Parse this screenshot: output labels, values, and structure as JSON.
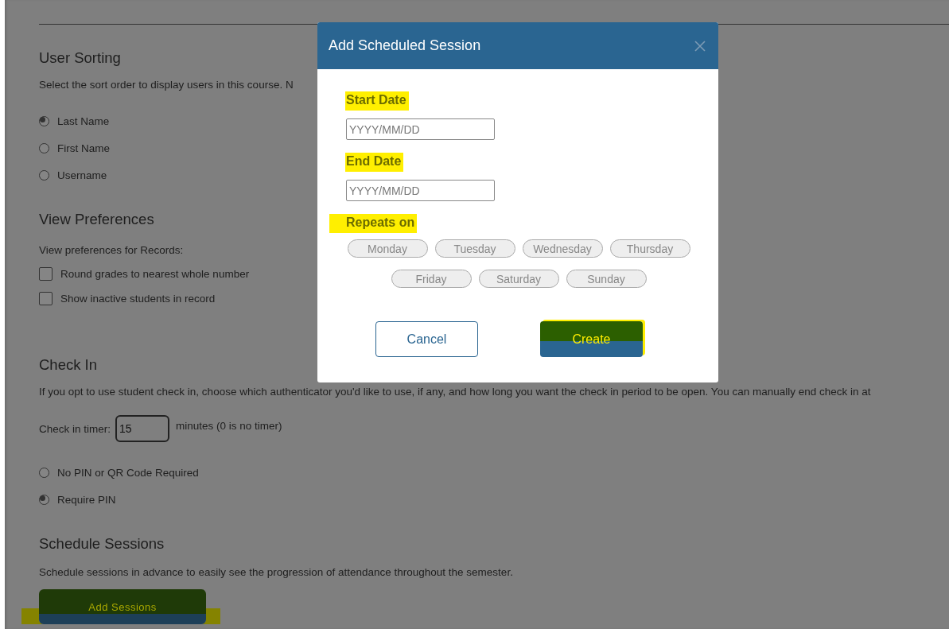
{
  "settings": {
    "user_sorting": {
      "title": "User Sorting",
      "description": "Select the sort order to display users in this course. N",
      "options": [
        {
          "label": "Last Name",
          "selected": true
        },
        {
          "label": "First Name",
          "selected": false
        },
        {
          "label": "Username",
          "selected": false
        }
      ]
    },
    "view_preferences": {
      "title": "View Preferences",
      "description": "View preferences for Records:",
      "options": [
        {
          "label": "Round grades to nearest whole number",
          "checked": false
        },
        {
          "label": "Show inactive students in record",
          "checked": false
        }
      ]
    },
    "check_in": {
      "title": "Check In",
      "description": "If you opt to use student check in, choose which authenticator you'd like to use, if any, and how long you want the check in period to be open. You can manually end check in at",
      "timer_label": "Check in timer:",
      "timer_value": "15",
      "timer_hint": "minutes (0 is no timer)",
      "options": [
        {
          "label": "No PIN or QR Code Required",
          "selected": false
        },
        {
          "label": "Require PIN",
          "selected": true
        }
      ]
    },
    "schedule_sessions": {
      "title": "Schedule Sessions",
      "description": "Schedule sessions in advance to easily see the progression of attendance throughout the semester.",
      "button": {
        "label": "Add Sessions",
        "highlighted": true
      }
    }
  },
  "dialog": {
    "title": "Add Scheduled Session",
    "fields": [
      {
        "label": "Start Date",
        "placeholder": "YYYY/MM/DD",
        "highlighted": true
      },
      {
        "label": "End Date",
        "placeholder": "YYYY/MM/DD",
        "highlighted": true
      }
    ],
    "repeats": {
      "label": "Repeats on",
      "highlighted": true,
      "days": [
        {
          "label": "Monday",
          "selected": false
        },
        {
          "label": "Tuesday",
          "selected": false
        },
        {
          "label": "Wednesday",
          "selected": false
        },
        {
          "label": "Thursday",
          "selected": false
        },
        {
          "label": "Friday",
          "selected": false
        },
        {
          "label": "Saturday",
          "selected": false
        },
        {
          "label": "Sunday",
          "selected": false
        }
      ]
    },
    "buttons": [
      {
        "label": "Cancel",
        "kind": "secondary"
      },
      {
        "label": "Create",
        "kind": "primary",
        "highlighted": true
      }
    ]
  }
}
